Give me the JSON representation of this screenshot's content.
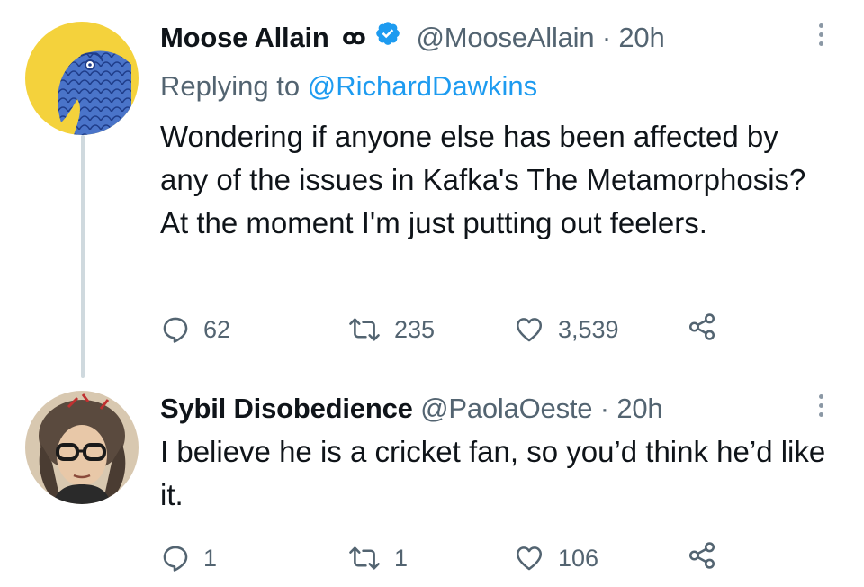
{
  "tweets": [
    {
      "display_name": "Moose Allain",
      "name_emoji": "ꝏ",
      "verified": true,
      "handle": "@MooseAllain",
      "separator": "·",
      "time": "20h",
      "replying_prefix": "Replying to",
      "replying_to": "@RichardDawkins",
      "text": "Wondering if anyone else has been affected by any of the issues in Kafka's The Metamorphosis? At the moment I'm just putting out feelers.",
      "replies": "62",
      "retweets": "235",
      "likes": "3,539",
      "icons": [
        "reply-icon",
        "retweet-icon",
        "like-icon",
        "share-icon",
        "more-icon"
      ]
    },
    {
      "display_name": "Sybil Disobedience",
      "handle": "@PaolaOeste",
      "separator": "·",
      "time": "20h",
      "text": "I believe he is a cricket fan, so you’d think he’d like it.",
      "replies": "1",
      "retweets": "1",
      "likes": "106",
      "icons": [
        "reply-icon",
        "retweet-icon",
        "like-icon",
        "share-icon",
        "more-icon"
      ]
    }
  ],
  "colors": {
    "text": "#0f1419",
    "secondary": "#536471",
    "link": "#1d9bf0",
    "verified": "#1d9bf0",
    "thread_line": "#cfd9de"
  }
}
